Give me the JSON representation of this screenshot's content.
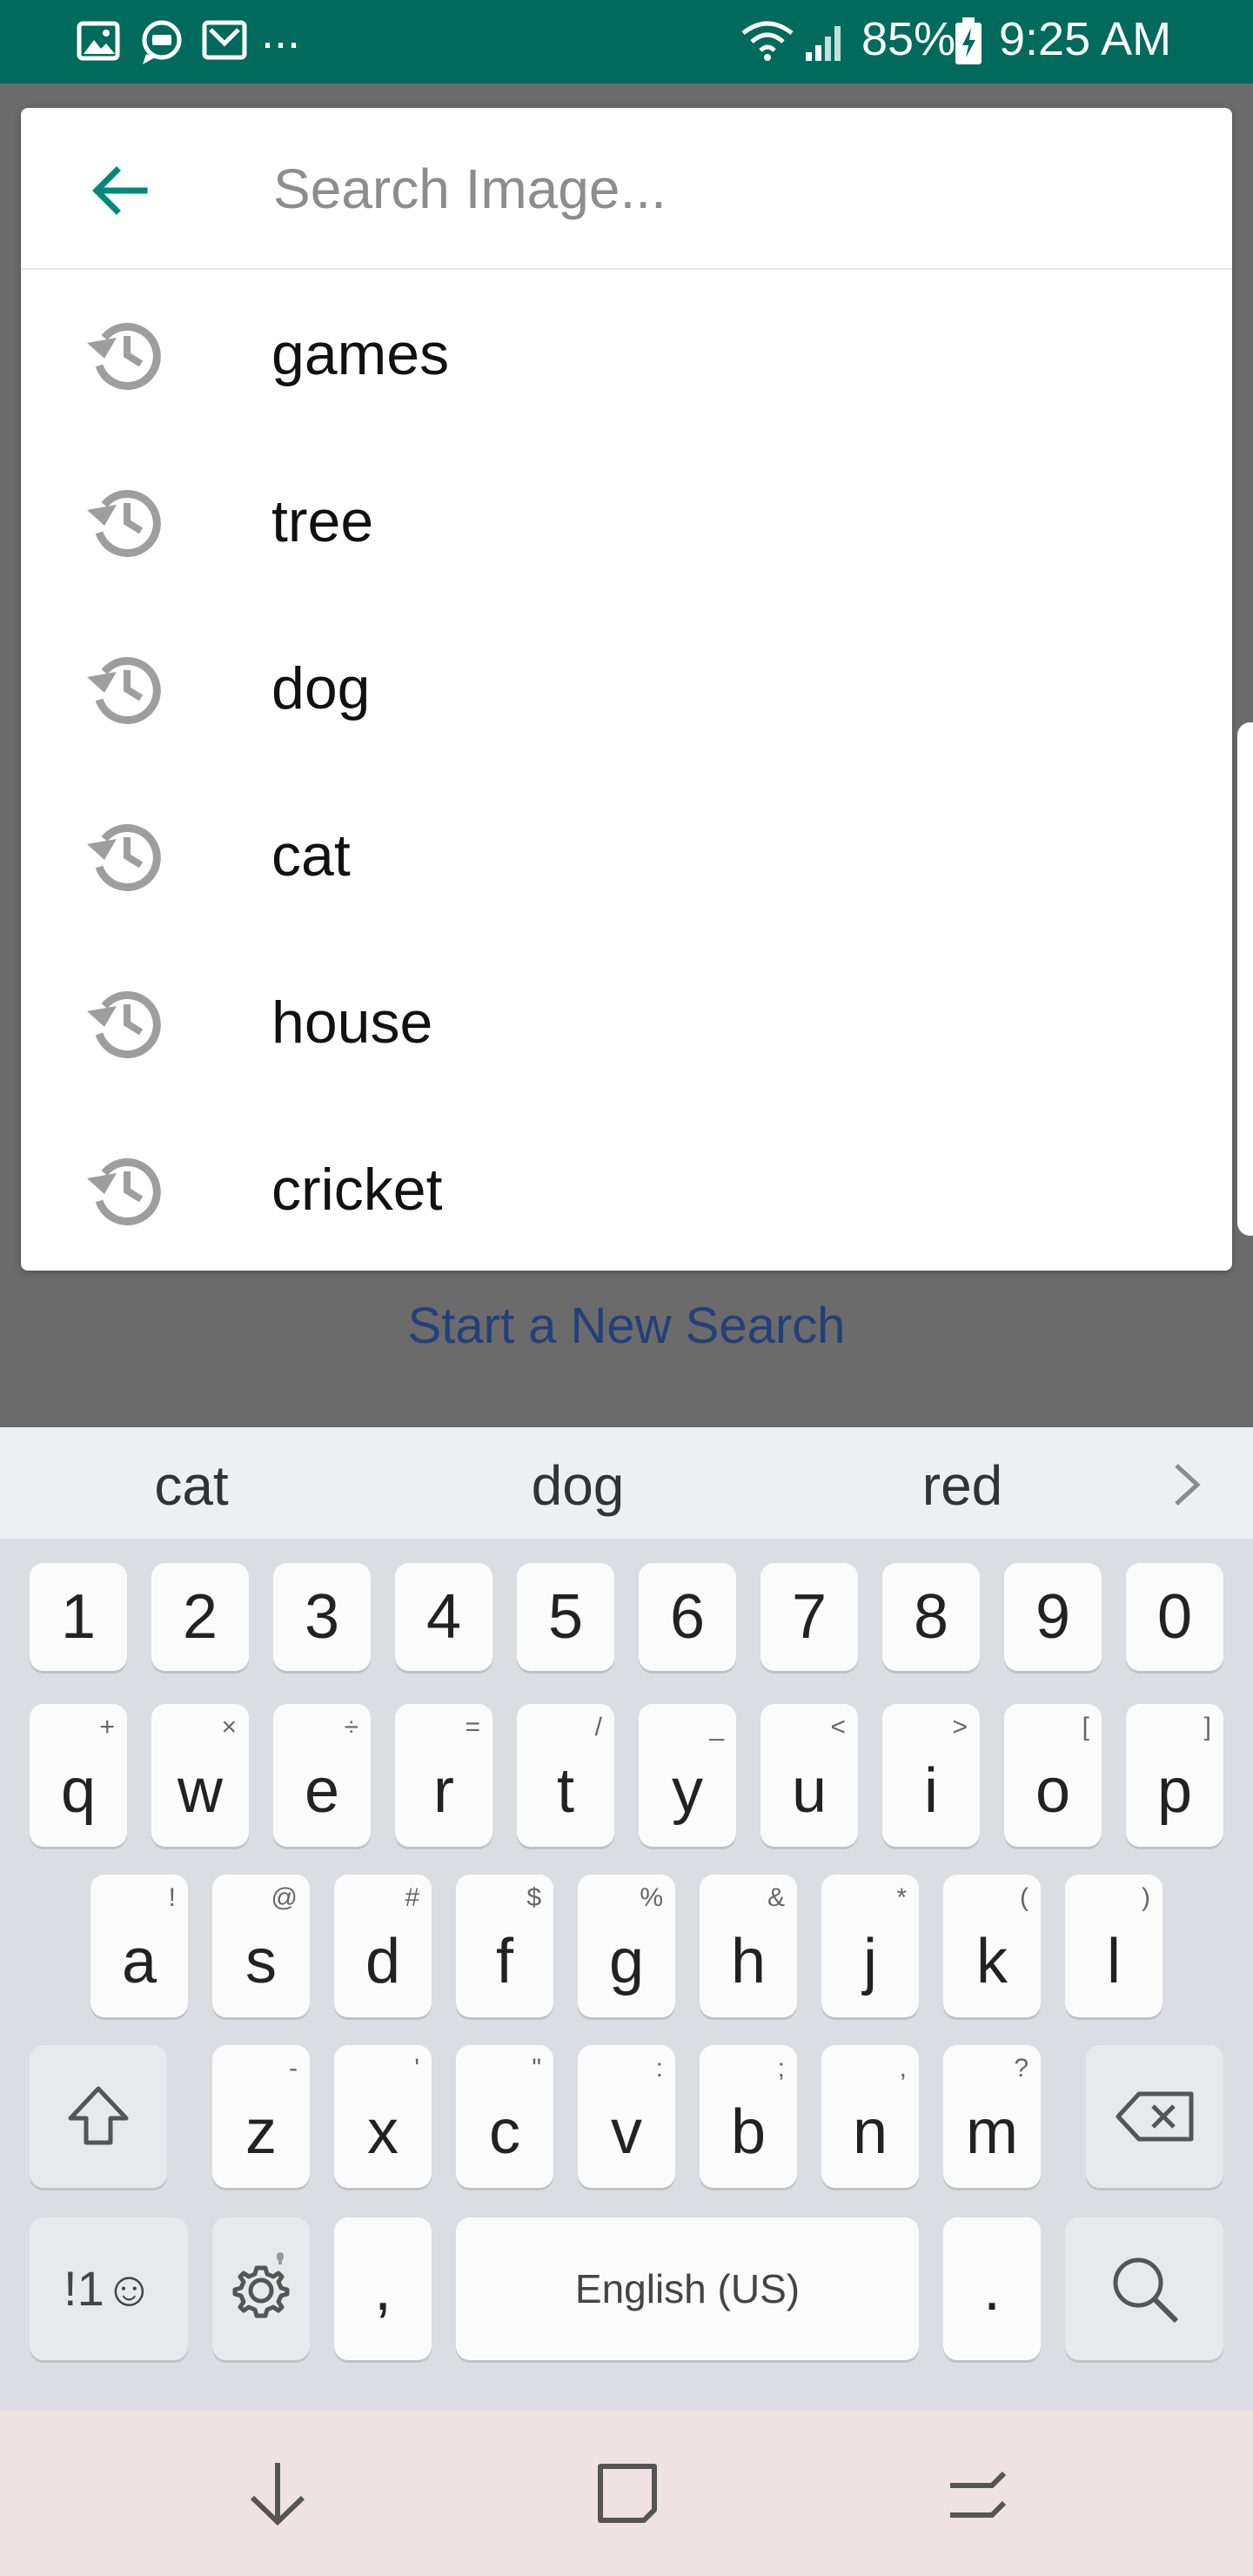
{
  "status_bar": {
    "notifications_more": "...",
    "battery": "85%",
    "time": "9:25 AM"
  },
  "search": {
    "placeholder": "Search Image...",
    "value": ""
  },
  "history": [
    {
      "label": "games"
    },
    {
      "label": "tree"
    },
    {
      "label": "dog"
    },
    {
      "label": "cat"
    },
    {
      "label": "house"
    },
    {
      "label": "cricket"
    }
  ],
  "start_new_search": "Start a New Search",
  "keyboard": {
    "suggestions": [
      "cat",
      "dog",
      "red"
    ],
    "number_row": [
      "1",
      "2",
      "3",
      "4",
      "5",
      "6",
      "7",
      "8",
      "9",
      "0"
    ],
    "row1": [
      {
        "key": "q",
        "alt": "+"
      },
      {
        "key": "w",
        "alt": "×"
      },
      {
        "key": "e",
        "alt": "÷"
      },
      {
        "key": "r",
        "alt": "="
      },
      {
        "key": "t",
        "alt": "/"
      },
      {
        "key": "y",
        "alt": "_"
      },
      {
        "key": "u",
        "alt": "<"
      },
      {
        "key": "i",
        "alt": ">"
      },
      {
        "key": "o",
        "alt": "["
      },
      {
        "key": "p",
        "alt": "]"
      }
    ],
    "row2": [
      {
        "key": "a",
        "alt": "!"
      },
      {
        "key": "s",
        "alt": "@"
      },
      {
        "key": "d",
        "alt": "#"
      },
      {
        "key": "f",
        "alt": "$"
      },
      {
        "key": "g",
        "alt": "%"
      },
      {
        "key": "h",
        "alt": "&"
      },
      {
        "key": "j",
        "alt": "*"
      },
      {
        "key": "k",
        "alt": "("
      },
      {
        "key": "l",
        "alt": ")"
      }
    ],
    "row3": [
      {
        "key": "z",
        "alt": "-"
      },
      {
        "key": "x",
        "alt": "'"
      },
      {
        "key": "c",
        "alt": "\""
      },
      {
        "key": "v",
        "alt": ":"
      },
      {
        "key": "b",
        "alt": ";"
      },
      {
        "key": "n",
        "alt": ","
      },
      {
        "key": "m",
        "alt": "?"
      }
    ],
    "symbols_label": "!1☺",
    "comma": ",",
    "space_label": "English (US)",
    "period": "."
  },
  "icons": {
    "back": "arrow-left-icon",
    "history": "history-icon",
    "shift": "shift-arrow-icon",
    "backspace": "backspace-icon",
    "settings": "gear-icon",
    "search": "search-icon",
    "nav_back": "nav-down-arrow-icon",
    "nav_home": "nav-square-icon",
    "nav_recents": "nav-recents-icon"
  },
  "colors": {
    "status_bar": "#006a5c",
    "accent": "#00897b",
    "link": "#22407a",
    "scrim": "#6b6b6b"
  }
}
